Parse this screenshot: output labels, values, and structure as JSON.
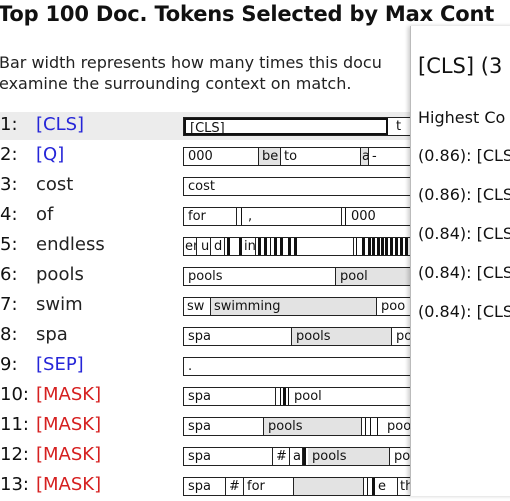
{
  "header": {
    "title": "Top 100 Doc. Tokens Selected by Max Cont",
    "description": "Bar width represents how many times this docu examine the surrounding context on match."
  },
  "rows": [
    {
      "rank": "1:",
      "token": "[CLS]",
      "kind": "special",
      "segments": [
        "[CLS]",
        "t"
      ]
    },
    {
      "rank": "2:",
      "token": "[Q]",
      "kind": "special",
      "segments": [
        "000",
        "be",
        "to",
        "a",
        "-"
      ]
    },
    {
      "rank": "3:",
      "token": "cost",
      "kind": "plain",
      "segments": [
        "cost"
      ]
    },
    {
      "rank": "4:",
      "token": "of",
      "kind": "plain",
      "segments": [
        "for",
        ",",
        "000"
      ]
    },
    {
      "rank": "5:",
      "token": "endless",
      "kind": "plain",
      "segments": [
        "en",
        "u",
        "d",
        "ing"
      ]
    },
    {
      "rank": "6:",
      "token": "pools",
      "kind": "plain",
      "segments": [
        "pools",
        "pool"
      ]
    },
    {
      "rank": "7:",
      "token": "swim",
      "kind": "plain",
      "segments": [
        "sw",
        "swimming",
        "poo"
      ]
    },
    {
      "rank": "8:",
      "token": "spa",
      "kind": "plain",
      "segments": [
        "spa",
        "pools",
        "po"
      ]
    },
    {
      "rank": "9:",
      "token": "[SEP]",
      "kind": "special",
      "segments": [
        "."
      ]
    },
    {
      "rank": "10:",
      "token": "[MASK]",
      "kind": "mask",
      "segments": [
        "spa",
        "pool"
      ]
    },
    {
      "rank": "11:",
      "token": "[MASK]",
      "kind": "mask",
      "segments": [
        "spa",
        "pools",
        "pool"
      ]
    },
    {
      "rank": "12:",
      "token": "[MASK]",
      "kind": "mask",
      "segments": [
        "spa",
        "#",
        "a",
        "pools",
        "pool"
      ]
    },
    {
      "rank": "13:",
      "token": "[MASK]",
      "kind": "mask",
      "segments": [
        "spa",
        "#",
        "for",
        "e",
        "the",
        "[C"
      ]
    }
  ],
  "popup": {
    "title": "[CLS] (3",
    "subtitle": "Highest Co",
    "items": [
      "(0.86): [CLS",
      "(0.86): [CLS",
      "(0.84): [CLS",
      "(0.84): [CLS",
      "(0.84): [CLS"
    ]
  },
  "colors": {
    "special": "#2525d8",
    "mask": "#d62020",
    "plain": "#222222",
    "highlight_row": "#ececec",
    "segment_grey": "#e3e3e3"
  }
}
